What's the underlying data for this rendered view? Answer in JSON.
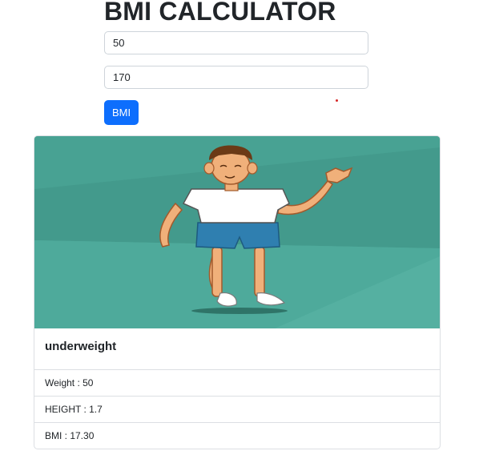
{
  "page": {
    "title": "BMI CALCULATOR"
  },
  "form": {
    "weight_value": "50",
    "height_value": "170",
    "submit_label": "BMI"
  },
  "result_card": {
    "category": "underweight",
    "details": [
      {
        "label": "Weight : 50"
      },
      {
        "label": "HEIGHT : 1.7"
      },
      {
        "label": "BMI : 17.30"
      }
    ],
    "image": {
      "subject": "cartoon-thin-boy-waving",
      "background_color": "#4aa598",
      "shirt_color": "#ffffff",
      "shorts_color": "#2f7fb0",
      "skin_color": "#f0b07a"
    }
  },
  "colors": {
    "primary": "#0d6efd",
    "text": "#212529",
    "border": "#dcdfe3"
  }
}
